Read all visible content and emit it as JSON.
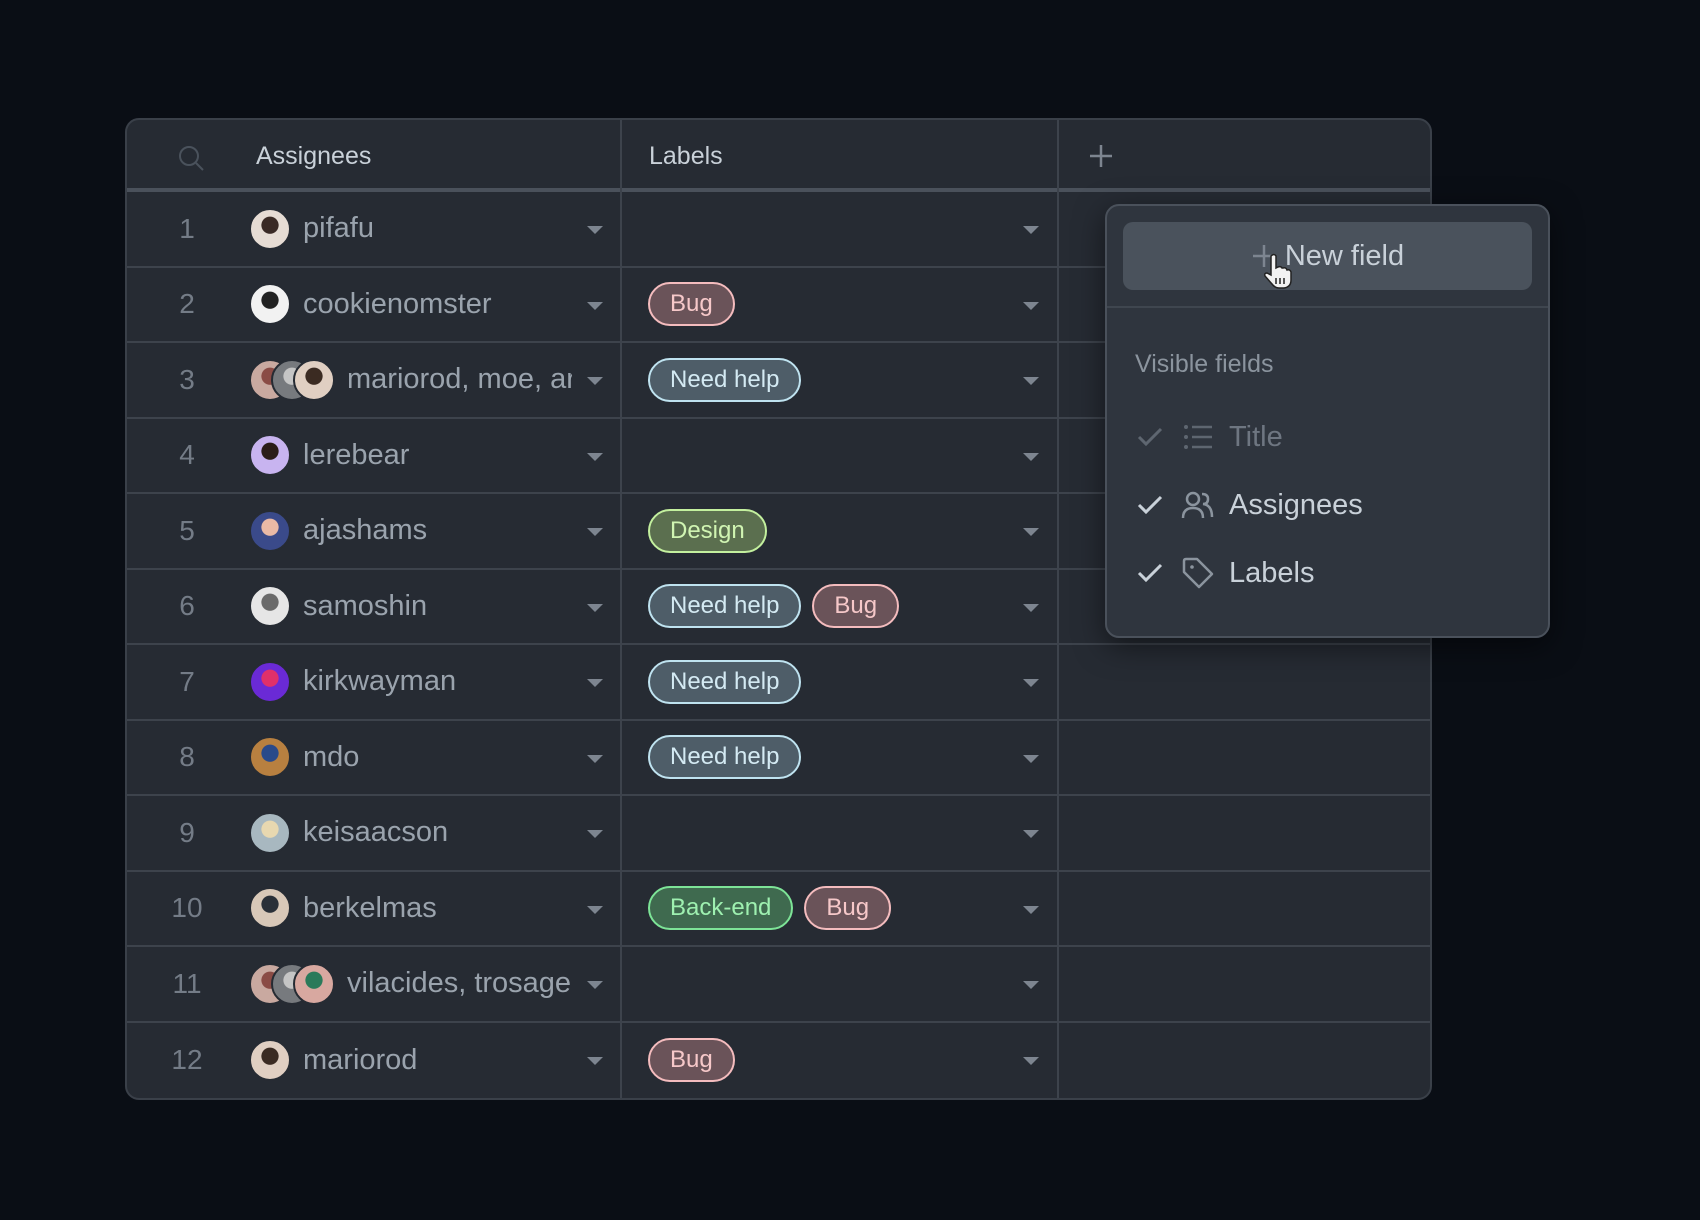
{
  "header": {
    "columns": [
      {
        "label": "Assignees"
      },
      {
        "label": "Labels"
      }
    ],
    "search_icon": "search-icon",
    "add_field_icon": "plus-icon"
  },
  "colors": {
    "background": "#0a0e15",
    "table": "#262b33",
    "popup": "#2f353e",
    "tag_bug": "#f4bcbe",
    "tag_need_help": "#bfe3f0",
    "tag_design": "#c3f09e",
    "tag_backend": "#7de497"
  },
  "rows": [
    {
      "num": "1",
      "assignees": "pifafu",
      "avatars": [
        {
          "bg": "#e6dcd4",
          "fg": "#3a2a25"
        }
      ],
      "labels": []
    },
    {
      "num": "2",
      "assignees": "cookienomster",
      "avatars": [
        {
          "bg": "#f2f2f2",
          "fg": "#222222"
        }
      ],
      "labels": [
        {
          "text": "Bug",
          "kind": "bug"
        }
      ]
    },
    {
      "num": "3",
      "assignees": "mariorod, moe, ar",
      "avatars": [
        {
          "bg": "#c9a9a0",
          "fg": "#8a4b45"
        },
        {
          "bg": "#777a7e",
          "fg": "#c5c5c5"
        },
        {
          "bg": "#e0cfc2",
          "fg": "#3b2b22"
        }
      ],
      "labels": [
        {
          "text": "Need help",
          "kind": "help"
        }
      ]
    },
    {
      "num": "4",
      "assignees": "lerebear",
      "avatars": [
        {
          "bg": "#c8b4f0",
          "fg": "#2b1d18"
        }
      ],
      "labels": []
    },
    {
      "num": "5",
      "assignees": "ajashams",
      "avatars": [
        {
          "bg": "#3a4a8a",
          "fg": "#e9b9a6"
        }
      ],
      "labels": [
        {
          "text": "Design",
          "kind": "design"
        }
      ]
    },
    {
      "num": "6",
      "assignees": "samoshin",
      "avatars": [
        {
          "bg": "#e6e6e6",
          "fg": "#6a6a6a"
        }
      ],
      "labels": [
        {
          "text": "Need help",
          "kind": "help"
        },
        {
          "text": "Bug",
          "kind": "bug"
        }
      ]
    },
    {
      "num": "7",
      "assignees": "kirkwayman",
      "avatars": [
        {
          "bg": "#6a2ad6",
          "fg": "#e0306a"
        }
      ],
      "labels": [
        {
          "text": "Need help",
          "kind": "help"
        }
      ]
    },
    {
      "num": "8",
      "assignees": "mdo",
      "avatars": [
        {
          "bg": "#b88040",
          "fg": "#2a4a8a"
        }
      ],
      "labels": [
        {
          "text": "Need help",
          "kind": "help"
        }
      ]
    },
    {
      "num": "9",
      "assignees": "keisaacson",
      "avatars": [
        {
          "bg": "#a8b8c0",
          "fg": "#e8d8b0"
        }
      ],
      "labels": []
    },
    {
      "num": "10",
      "assignees": "berkelmas",
      "avatars": [
        {
          "bg": "#d8c8b8",
          "fg": "#2a3038"
        }
      ],
      "labels": [
        {
          "text": "Back-end",
          "kind": "backend"
        },
        {
          "text": "Bug",
          "kind": "bug"
        }
      ]
    },
    {
      "num": "11",
      "assignees": "vilacides, trosage",
      "avatars": [
        {
          "bg": "#c9a9a0",
          "fg": "#8a4b45"
        },
        {
          "bg": "#777a7e",
          "fg": "#c5c5c5"
        },
        {
          "bg": "#d8a8a0",
          "fg": "#2a7a5a"
        }
      ],
      "labels": []
    },
    {
      "num": "12",
      "assignees": "mariorod",
      "avatars": [
        {
          "bg": "#e0cfc2",
          "fg": "#3b2b22"
        }
      ],
      "labels": [
        {
          "text": "Bug",
          "kind": "bug"
        }
      ]
    }
  ],
  "popup": {
    "new_field_label": "New field",
    "visible_fields_title": "Visible fields",
    "fields": [
      {
        "label": "Title",
        "icon": "list-icon",
        "checked": true,
        "disabled": true
      },
      {
        "label": "Assignees",
        "icon": "people-icon",
        "checked": true,
        "disabled": false
      },
      {
        "label": "Labels",
        "icon": "tag-icon",
        "checked": true,
        "disabled": false
      }
    ]
  }
}
